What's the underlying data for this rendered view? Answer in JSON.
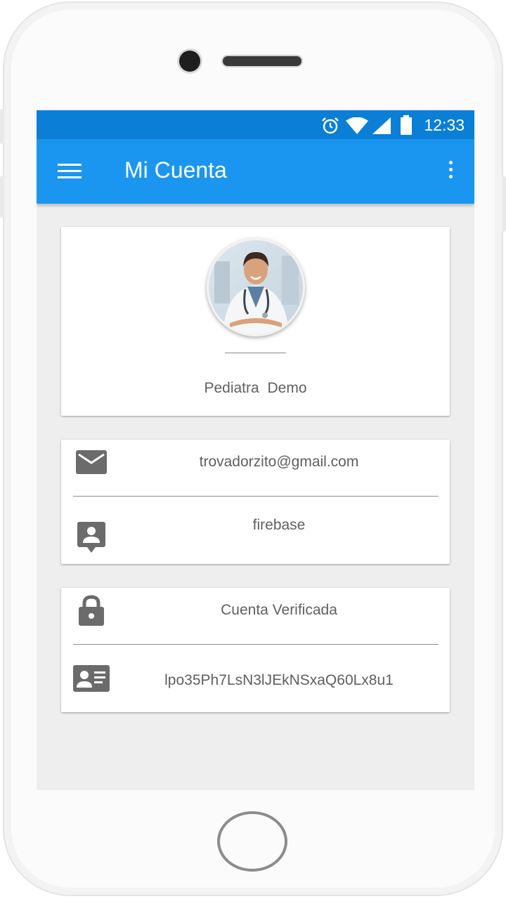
{
  "status_bar": {
    "time": "12:33"
  },
  "app_bar": {
    "title": "Mi Cuenta"
  },
  "profile": {
    "name": "Pediatra  Demo"
  },
  "contact": {
    "email": "trovadorzito@gmail.com",
    "provider": "firebase"
  },
  "account": {
    "status": "Cuenta Verificada",
    "uid": "lpo35Ph7LsN3lJEkNSxaQ60Lx8u1"
  },
  "icons": {
    "menu": "hamburger-menu-icon",
    "more": "more-vertical-icon",
    "email": "email-icon",
    "provider": "account-box-icon",
    "verified": "lock-icon",
    "uid": "id-card-icon"
  },
  "colors": {
    "status_bar": "#0b7fd6",
    "app_bar": "#1a96f0",
    "background": "#eeeeee",
    "icon": "#6b6b6b",
    "text": "#5f5f5f"
  }
}
